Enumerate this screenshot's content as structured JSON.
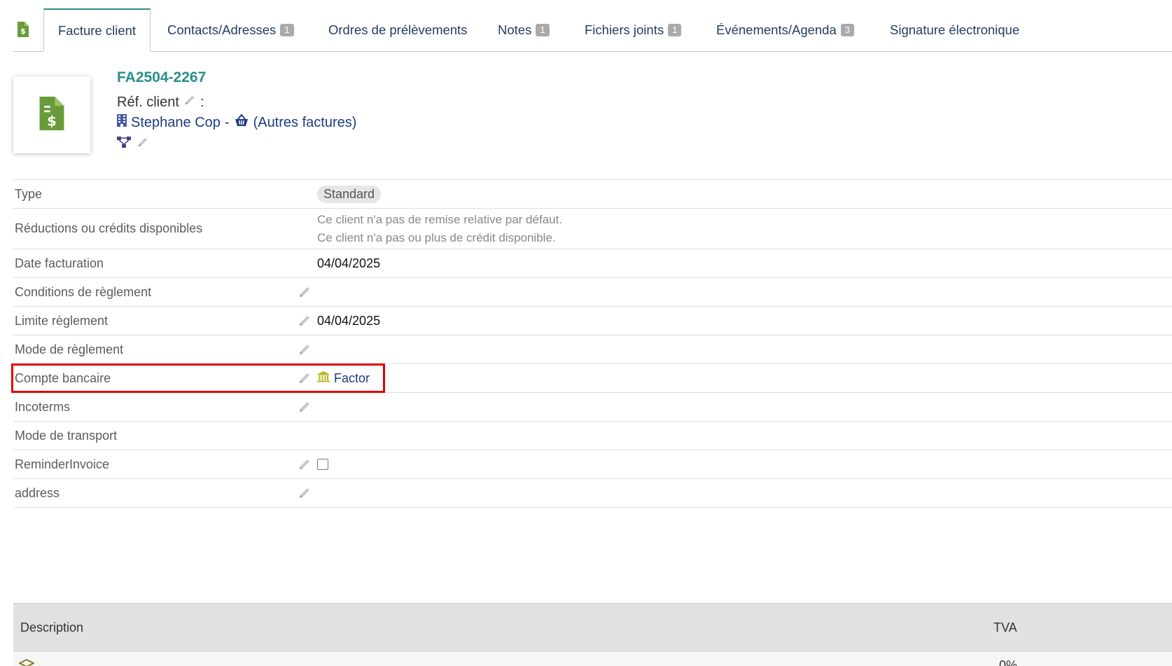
{
  "tabs": [
    {
      "label": "Facture client",
      "badge": null,
      "active": true
    },
    {
      "label": "Contacts/Adresses",
      "badge": "1"
    },
    {
      "label": "Ordres de prélèvements",
      "badge": null
    },
    {
      "label": "Notes",
      "badge": "1"
    },
    {
      "label": "Fichiers joints",
      "badge": "1"
    },
    {
      "label": "Événements/Agenda",
      "badge": "3"
    },
    {
      "label": "Signature électronique",
      "badge": null
    }
  ],
  "invoice": {
    "ref": "FA2504-2267",
    "ref_client_label": "Réf. client",
    "ref_client_sep": ":",
    "thirdparty_name": "Stephane Cop",
    "thirdparty_sep": "-",
    "other_invoices": "(Autres factures)"
  },
  "fields": {
    "type": {
      "label": "Type",
      "value": "Standard"
    },
    "discounts": {
      "label": "Réductions ou crédits disponibles",
      "line1": "Ce client n'a pas de remise relative par défaut.",
      "line2": "Ce client n'a pas ou plus de crédit disponible."
    },
    "date": {
      "label": "Date facturation",
      "value": "04/04/2025"
    },
    "payment_terms": {
      "label": "Conditions de règlement",
      "value": ""
    },
    "due_date": {
      "label": "Limite règlement",
      "value": "04/04/2025"
    },
    "payment_mode": {
      "label": "Mode de règlement",
      "value": ""
    },
    "bank_account": {
      "label": "Compte bancaire",
      "value": "Factor"
    },
    "incoterms": {
      "label": "Incoterms",
      "value": ""
    },
    "transport": {
      "label": "Mode de transport",
      "value": ""
    },
    "reminder": {
      "label": "ReminderInvoice",
      "checked": false
    },
    "address": {
      "label": "address",
      "value": ""
    }
  },
  "lines": {
    "col_description": "Description",
    "col_tva": "TVA",
    "first_row_tva": "0%"
  },
  "colors": {
    "accent": "#2a8f8a",
    "link": "#1f3a83",
    "invoice_icon": "#6a9b3a",
    "highlight": "#e00000"
  }
}
